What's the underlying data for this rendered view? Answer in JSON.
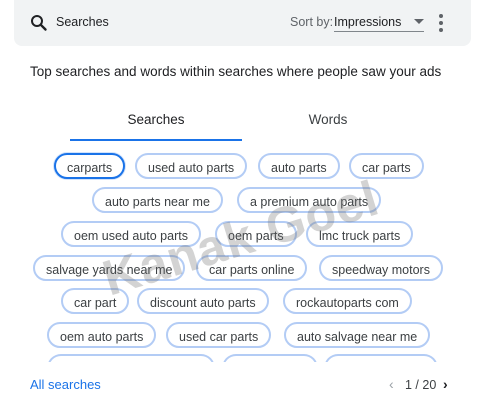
{
  "header": {
    "search_label": "Searches",
    "sort_prefix": "Sort by:",
    "sort_value": "Impressions"
  },
  "subtitle": "Top searches and words within searches where people saw your ads",
  "tabs": [
    {
      "label": "Searches",
      "selected": true
    },
    {
      "label": "Words",
      "selected": false
    }
  ],
  "chips": [
    "carparts",
    "used auto parts",
    "auto parts",
    "car parts",
    "auto parts near me",
    "a premium auto parts",
    "oem used auto parts",
    "oem parts",
    "lmc truck parts",
    "salvage yards near me",
    "car parts online",
    "speedway motors",
    "car part",
    "discount auto parts",
    "rockautoparts com",
    "oem auto parts",
    "used car parts",
    "auto salvage near me"
  ],
  "selected_chip": "carparts",
  "footer": {
    "all_searches_label": "All searches",
    "pager_text": "1 / 20",
    "prev_glyph": "‹",
    "next_glyph": "›"
  },
  "watermark": "Kanak Goel",
  "colors": {
    "accent": "#1a73e8",
    "chip_border": "#b3ccf5",
    "header_bg": "#f1f3f4"
  }
}
